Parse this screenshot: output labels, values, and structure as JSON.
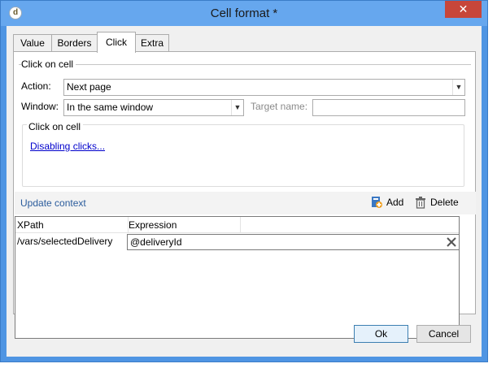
{
  "window": {
    "title": "Cell format *",
    "app_icon_glyph": "d",
    "close_glyph": "✕"
  },
  "tabs": [
    {
      "label": "Value"
    },
    {
      "label": "Borders"
    },
    {
      "label": "Click",
      "active": true
    },
    {
      "label": "Extra"
    }
  ],
  "click_panel": {
    "section_title": "Click on cell",
    "action_label": "Action:",
    "action_value": "Next page",
    "window_label": "Window:",
    "window_value": "In the same window",
    "target_label": "Target name:",
    "target_value": "",
    "group_title": "Click on cell",
    "disable_link": "Disabling clicks..."
  },
  "context": {
    "title": "Update context",
    "add_label": "Add",
    "delete_label": "Delete",
    "columns": [
      "XPath",
      "Expression"
    ],
    "rows": [
      {
        "xpath": "/vars/selectedDelivery",
        "expression": "@deliveryId"
      }
    ]
  },
  "buttons": {
    "ok_label": "Ok",
    "cancel_label": "Cancel"
  },
  "icons": {
    "combo_arrow": "chevron-down-icon",
    "add": "add-icon",
    "delete": "trash-icon",
    "clear": "close-icon"
  }
}
